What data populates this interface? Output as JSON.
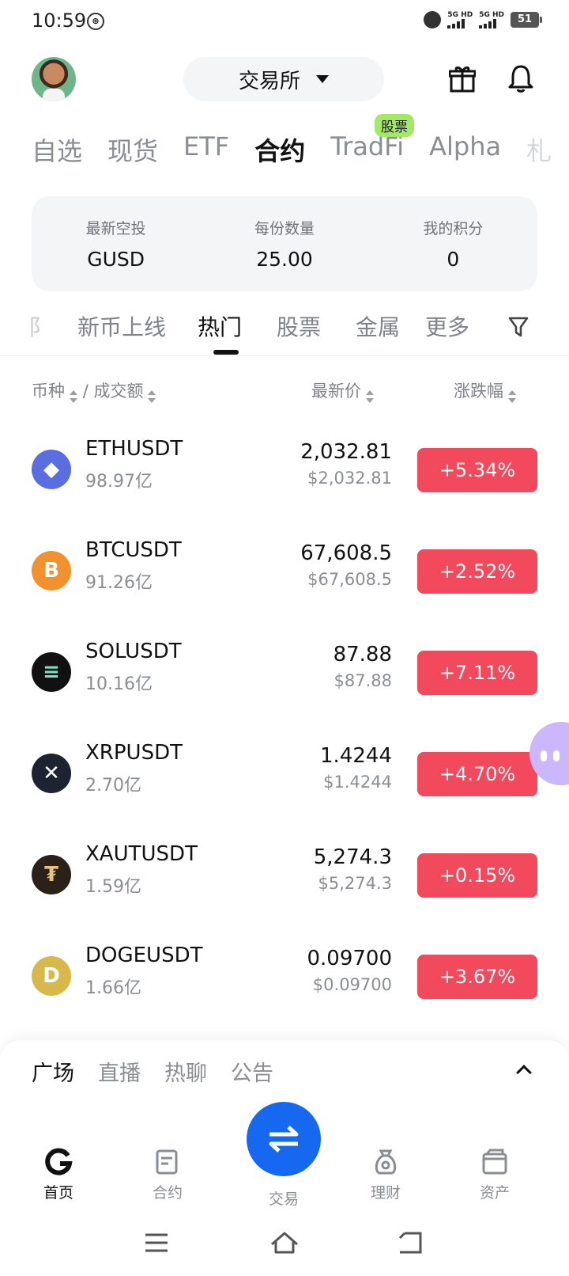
{
  "status_bar": {
    "time": "10:59",
    "battery": "51",
    "net1": "5G HD",
    "net2": "5G HD"
  },
  "header": {
    "exchange_label": "交易所"
  },
  "market_tabs": {
    "items": [
      "自选",
      "现货",
      "ETF",
      "合约",
      "TradFi",
      "Alpha",
      "札"
    ],
    "active": "合约",
    "badge": "股票"
  },
  "airdrop": {
    "cols": [
      {
        "label": "最新空投",
        "value": "GUSD"
      },
      {
        "label": "每份数量",
        "value": "25.00"
      },
      {
        "label": "我的积分",
        "value": "0"
      }
    ]
  },
  "sub_tabs": {
    "items": [
      "阝",
      "新币上线",
      "热门",
      "股票",
      "金属",
      "更多"
    ],
    "active": "热门"
  },
  "columns": {
    "coin": "币种",
    "sep": "/",
    "volume": "成交额",
    "price": "最新价",
    "change": "涨跌幅"
  },
  "rows": [
    {
      "name": "ETHUSDT",
      "volume": "98.97亿",
      "price": "2,032.81",
      "price_usd": "$2,032.81",
      "change": "+5.34%",
      "icon": "ethereum-icon",
      "color": "#5b6ee1",
      "glyph": "◆"
    },
    {
      "name": "BTCUSDT",
      "volume": "91.26亿",
      "price": "67,608.5",
      "price_usd": "$67,608.5",
      "change": "+2.52%",
      "icon": "bitcoin-icon",
      "color": "#f2922f",
      "glyph": "B"
    },
    {
      "name": "SOLUSDT",
      "volume": "10.16亿",
      "price": "87.88",
      "price_usd": "$87.88",
      "change": "+7.11%",
      "icon": "solana-icon",
      "color": "#111111",
      "glyph": "≡"
    },
    {
      "name": "XRPUSDT",
      "volume": "2.70亿",
      "price": "1.4244",
      "price_usd": "$1.4244",
      "change": "+4.70%",
      "icon": "xrp-icon",
      "color": "#1d2330",
      "glyph": "✕"
    },
    {
      "name": "XAUTUSDT",
      "volume": "1.59亿",
      "price": "5,274.3",
      "price_usd": "$5,274.3",
      "change": "+0.15%",
      "icon": "tether-gold-icon",
      "color": "#2b2118",
      "glyph": "₮"
    },
    {
      "name": "DOGEUSDT",
      "volume": "1.66亿",
      "price": "0.09700",
      "price_usd": "$0.09700",
      "change": "+3.67%",
      "icon": "dogecoin-icon",
      "color": "#d8b84a",
      "glyph": "D"
    }
  ],
  "feed_tabs": {
    "items": [
      "广场",
      "直播",
      "热聊",
      "公告"
    ],
    "active": "广场"
  },
  "bottom_nav": {
    "home": "首页",
    "futures": "合约",
    "trade": "交易",
    "earn": "理财",
    "assets": "资产"
  },
  "colors": {
    "accent": "#1768f0",
    "up": "#f2495c",
    "badge": "#a4e86a"
  }
}
